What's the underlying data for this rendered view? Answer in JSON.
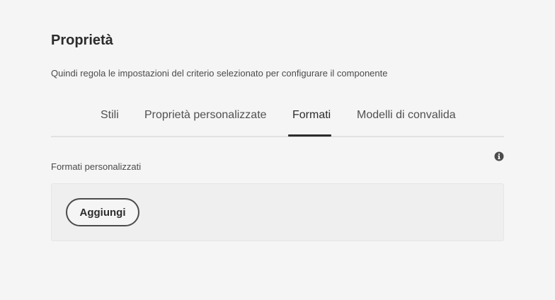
{
  "panel": {
    "title": "Proprietà",
    "description": "Quindi regola le impostazioni del criterio selezionato per configurare il componente"
  },
  "tabs": [
    {
      "label": "Stili",
      "selected": false
    },
    {
      "label": "Proprietà personalizzate",
      "selected": false
    },
    {
      "label": "Formati",
      "selected": true
    },
    {
      "label": "Modelli di convalida",
      "selected": false
    }
  ],
  "field": {
    "label": "Formati personalizzati",
    "info_icon": "info-icon",
    "add_label": "Aggiungi"
  }
}
